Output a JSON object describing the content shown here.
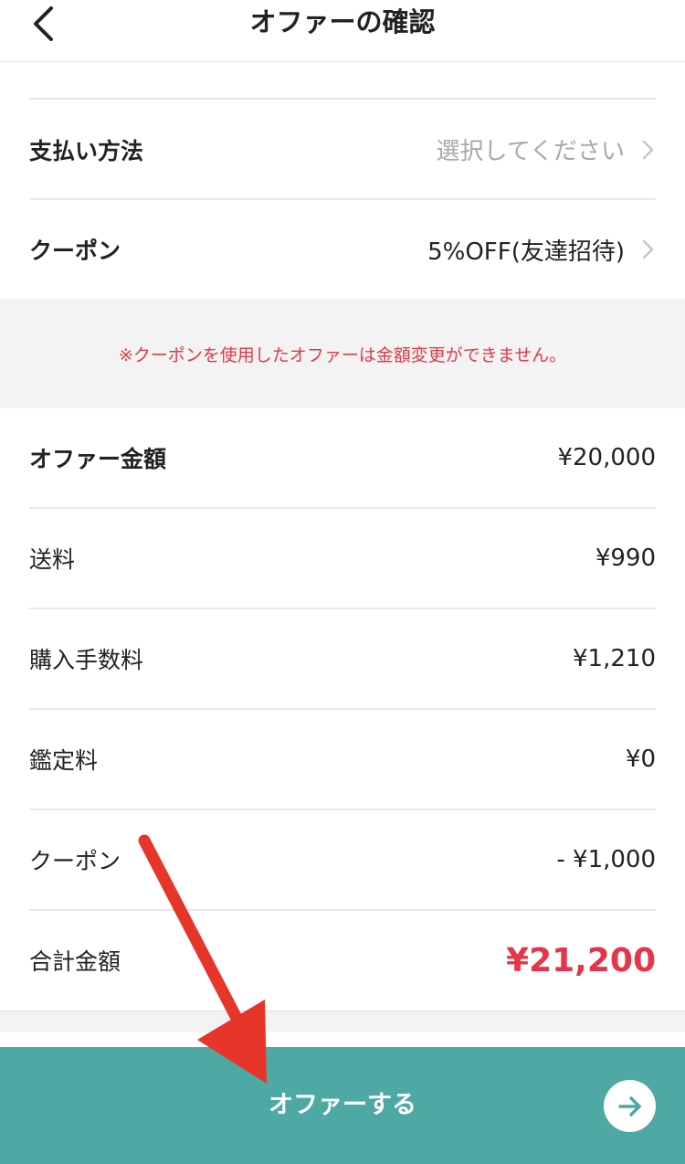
{
  "header": {
    "title": "オファーの確認"
  },
  "payment": {
    "label": "支払い方法",
    "value": "選択してください"
  },
  "coupon_select": {
    "label": "クーポン",
    "value": "5%OFF(友達招待)"
  },
  "notice": "※クーポンを使用したオファーは金額変更ができません。",
  "breakdown": [
    {
      "label": "オファー金額",
      "value": "¥20,000"
    },
    {
      "label": "送料",
      "value": "¥990"
    },
    {
      "label": "購入手数料",
      "value": "¥1,210"
    },
    {
      "label": "鑑定料",
      "value": "¥0"
    },
    {
      "label": "クーポン",
      "value": "- ¥1,000"
    }
  ],
  "total": {
    "label": "合計金額",
    "value": "¥21,200"
  },
  "cta": {
    "label": "オファーする"
  },
  "icons": {
    "back": "chevron-left-icon",
    "row_chevron": "chevron-right-icon",
    "cta_arrow": "arrow-right-icon",
    "annotation": "red-arrow-annotation"
  },
  "colors": {
    "accent": "#4ea8a3",
    "total_red": "#e5354a",
    "notice_red": "#e0394a",
    "annotation_red": "#e8352a"
  }
}
